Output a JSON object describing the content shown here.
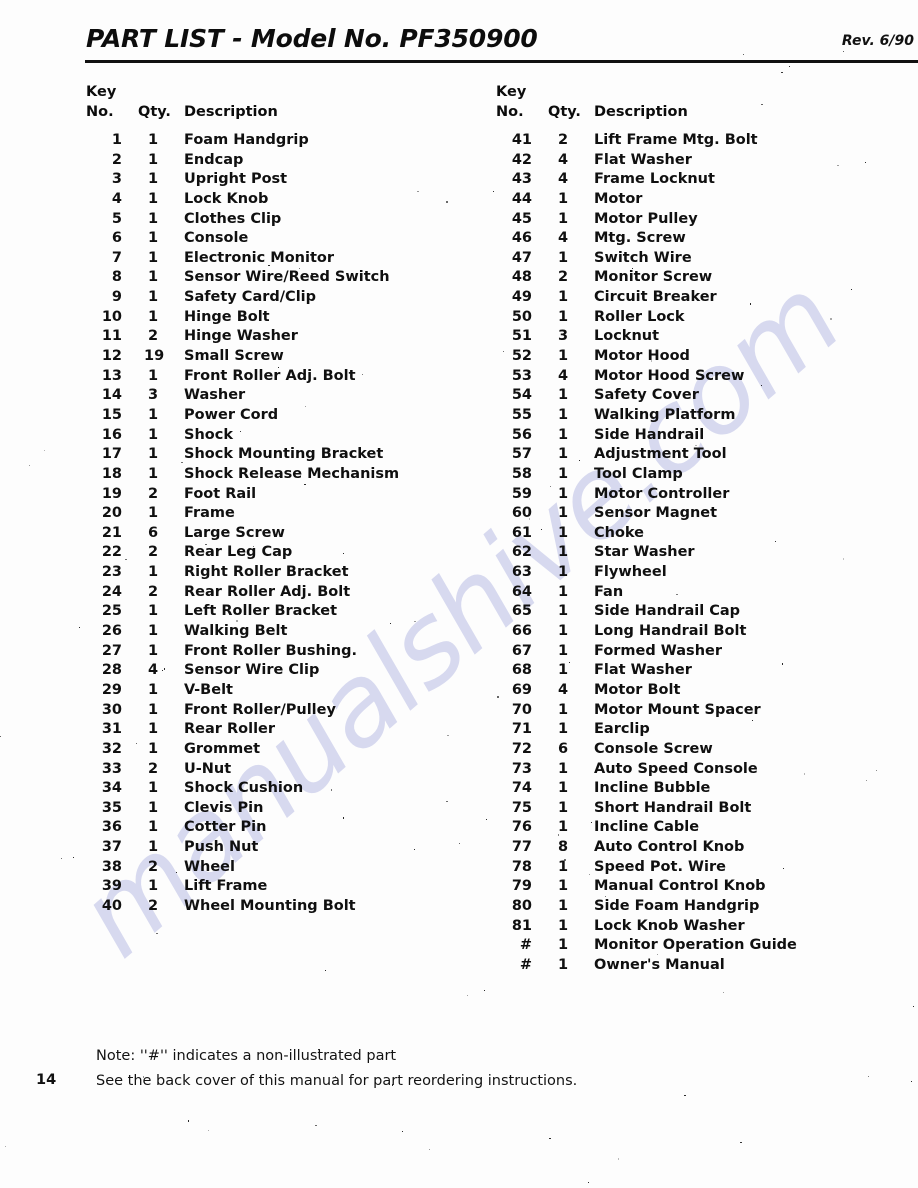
{
  "document": {
    "title": "PART LIST - Model No. PF350900",
    "revision": "Rev. 6/90",
    "page_number": "14",
    "watermark": "manualshive.com",
    "colors": {
      "text": "#101010",
      "rule": "#111111",
      "watermark": "#b9bde4",
      "background": "#fdfdfd"
    }
  },
  "table": {
    "headers": {
      "key": "Key",
      "no": "No.",
      "qty": "Qty.",
      "description": "Description"
    },
    "left_column": [
      {
        "key": "1",
        "qty": "1",
        "description": "Foam Handgrip"
      },
      {
        "key": "2",
        "qty": "1",
        "description": "Endcap"
      },
      {
        "key": "3",
        "qty": "1",
        "description": "Upright Post"
      },
      {
        "key": "4",
        "qty": "1",
        "description": "Lock Knob"
      },
      {
        "key": "5",
        "qty": "1",
        "description": "Clothes Clip"
      },
      {
        "key": "6",
        "qty": "1",
        "description": "Console"
      },
      {
        "key": "7",
        "qty": "1",
        "description": "Electronic Monitor"
      },
      {
        "key": "8",
        "qty": "1",
        "description": "Sensor Wire/Reed Switch"
      },
      {
        "key": "9",
        "qty": "1",
        "description": "Safety Card/Clip"
      },
      {
        "key": "10",
        "qty": "1",
        "description": "Hinge Bolt"
      },
      {
        "key": "11",
        "qty": "2",
        "description": "Hinge Washer"
      },
      {
        "key": "12",
        "qty": "19",
        "description": "Small Screw"
      },
      {
        "key": "13",
        "qty": "1",
        "description": "Front Roller Adj. Bolt"
      },
      {
        "key": "14",
        "qty": "3",
        "description": "Washer"
      },
      {
        "key": "15",
        "qty": "1",
        "description": "Power Cord"
      },
      {
        "key": "16",
        "qty": "1",
        "description": "Shock"
      },
      {
        "key": "17",
        "qty": "1",
        "description": "Shock Mounting Bracket"
      },
      {
        "key": "18",
        "qty": "1",
        "description": "Shock Release Mechanism"
      },
      {
        "key": "19",
        "qty": "2",
        "description": "Foot Rail"
      },
      {
        "key": "20",
        "qty": "1",
        "description": "Frame"
      },
      {
        "key": "21",
        "qty": "6",
        "description": "Large Screw"
      },
      {
        "key": "22",
        "qty": "2",
        "description": "Rear Leg Cap"
      },
      {
        "key": "23",
        "qty": "1",
        "description": "Right Roller Bracket"
      },
      {
        "key": "24",
        "qty": "2",
        "description": "Rear Roller Adj. Bolt"
      },
      {
        "key": "25",
        "qty": "1",
        "description": "Left Roller Bracket"
      },
      {
        "key": "26",
        "qty": "1",
        "description": "Walking Belt"
      },
      {
        "key": "27",
        "qty": "1",
        "description": "Front Roller Bushing."
      },
      {
        "key": "28",
        "qty": "4",
        "description": "Sensor Wire Clip"
      },
      {
        "key": "29",
        "qty": "1",
        "description": "V-Belt"
      },
      {
        "key": "30",
        "qty": "1",
        "description": "Front Roller/Pulley"
      },
      {
        "key": "31",
        "qty": "1",
        "description": "Rear Roller"
      },
      {
        "key": "32",
        "qty": "1",
        "description": "Grommet"
      },
      {
        "key": "33",
        "qty": "2",
        "description": "U-Nut"
      },
      {
        "key": "34",
        "qty": "1",
        "description": "Shock Cushion"
      },
      {
        "key": "35",
        "qty": "1",
        "description": "Clevis Pin"
      },
      {
        "key": "36",
        "qty": "1",
        "description": "Cotter Pin"
      },
      {
        "key": "37",
        "qty": "1",
        "description": "Push Nut"
      },
      {
        "key": "38",
        "qty": "2",
        "description": "Wheel"
      },
      {
        "key": "39",
        "qty": "1",
        "description": "Lift Frame"
      },
      {
        "key": "40",
        "qty": "2",
        "description": "Wheel Mounting Bolt"
      }
    ],
    "right_column": [
      {
        "key": "41",
        "qty": "2",
        "description": "Lift Frame Mtg. Bolt"
      },
      {
        "key": "42",
        "qty": "4",
        "description": "Flat Washer"
      },
      {
        "key": "43",
        "qty": "4",
        "description": "Frame Locknut"
      },
      {
        "key": "44",
        "qty": "1",
        "description": "Motor"
      },
      {
        "key": "45",
        "qty": "1",
        "description": "Motor Pulley"
      },
      {
        "key": "46",
        "qty": "4",
        "description": "Mtg. Screw"
      },
      {
        "key": "47",
        "qty": "1",
        "description": "Switch Wire"
      },
      {
        "key": "48",
        "qty": "2",
        "description": "Monitor Screw"
      },
      {
        "key": "49",
        "qty": "1",
        "description": "Circuit Breaker"
      },
      {
        "key": "50",
        "qty": "1",
        "description": "Roller Lock"
      },
      {
        "key": "51",
        "qty": "3",
        "description": "Locknut"
      },
      {
        "key": "52",
        "qty": "1",
        "description": "Motor Hood"
      },
      {
        "key": "53",
        "qty": "4",
        "description": "Motor Hood Screw"
      },
      {
        "key": "54",
        "qty": "1",
        "description": "Safety Cover"
      },
      {
        "key": "55",
        "qty": "1",
        "description": "Walking Platform"
      },
      {
        "key": "56",
        "qty": "1",
        "description": "Side Handrail"
      },
      {
        "key": "57",
        "qty": "1",
        "description": "Adjustment Tool"
      },
      {
        "key": "58",
        "qty": "1",
        "description": "Tool Clamp"
      },
      {
        "key": "59",
        "qty": "1",
        "description": "Motor Controller"
      },
      {
        "key": "60",
        "qty": "1",
        "description": "Sensor Magnet"
      },
      {
        "key": "61",
        "qty": "1",
        "description": "Choke"
      },
      {
        "key": "62",
        "qty": "1",
        "description": "Star Washer"
      },
      {
        "key": "63",
        "qty": "1",
        "description": "Flywheel"
      },
      {
        "key": "64",
        "qty": "1",
        "description": "Fan"
      },
      {
        "key": "65",
        "qty": "1",
        "description": "Side Handrail Cap"
      },
      {
        "key": "66",
        "qty": "1",
        "description": "Long Handrail Bolt"
      },
      {
        "key": "67",
        "qty": "1",
        "description": "Formed Washer"
      },
      {
        "key": "68",
        "qty": "1",
        "description": "Flat Washer"
      },
      {
        "key": "69",
        "qty": "4",
        "description": "Motor Bolt"
      },
      {
        "key": "70",
        "qty": "1",
        "description": "Motor Mount Spacer"
      },
      {
        "key": "71",
        "qty": "1",
        "description": "Earclip"
      },
      {
        "key": "72",
        "qty": "6",
        "description": "Console Screw"
      },
      {
        "key": "73",
        "qty": "1",
        "description": "Auto Speed Console"
      },
      {
        "key": "74",
        "qty": "1",
        "description": "Incline Bubble"
      },
      {
        "key": "75",
        "qty": "1",
        "description": "Short Handrail Bolt"
      },
      {
        "key": "76",
        "qty": "1",
        "description": "Incline Cable"
      },
      {
        "key": "77",
        "qty": "8",
        "description": "Auto Control Knob"
      },
      {
        "key": "78",
        "qty": "1",
        "description": "Speed Pot. Wire"
      },
      {
        "key": "79",
        "qty": "1",
        "description": "Manual Control Knob"
      },
      {
        "key": "80",
        "qty": "1",
        "description": "Side Foam Handgrip"
      },
      {
        "key": "81",
        "qty": "1",
        "description": "Lock Knob Washer"
      },
      {
        "key": "#",
        "qty": "1",
        "description": "Monitor Operation Guide"
      },
      {
        "key": "#",
        "qty": "1",
        "description": "Owner's Manual"
      }
    ]
  },
  "footer": {
    "note": "Note: ''#'' indicates a non-illustrated part",
    "reorder": "See the back cover of this manual for part reordering instructions."
  }
}
